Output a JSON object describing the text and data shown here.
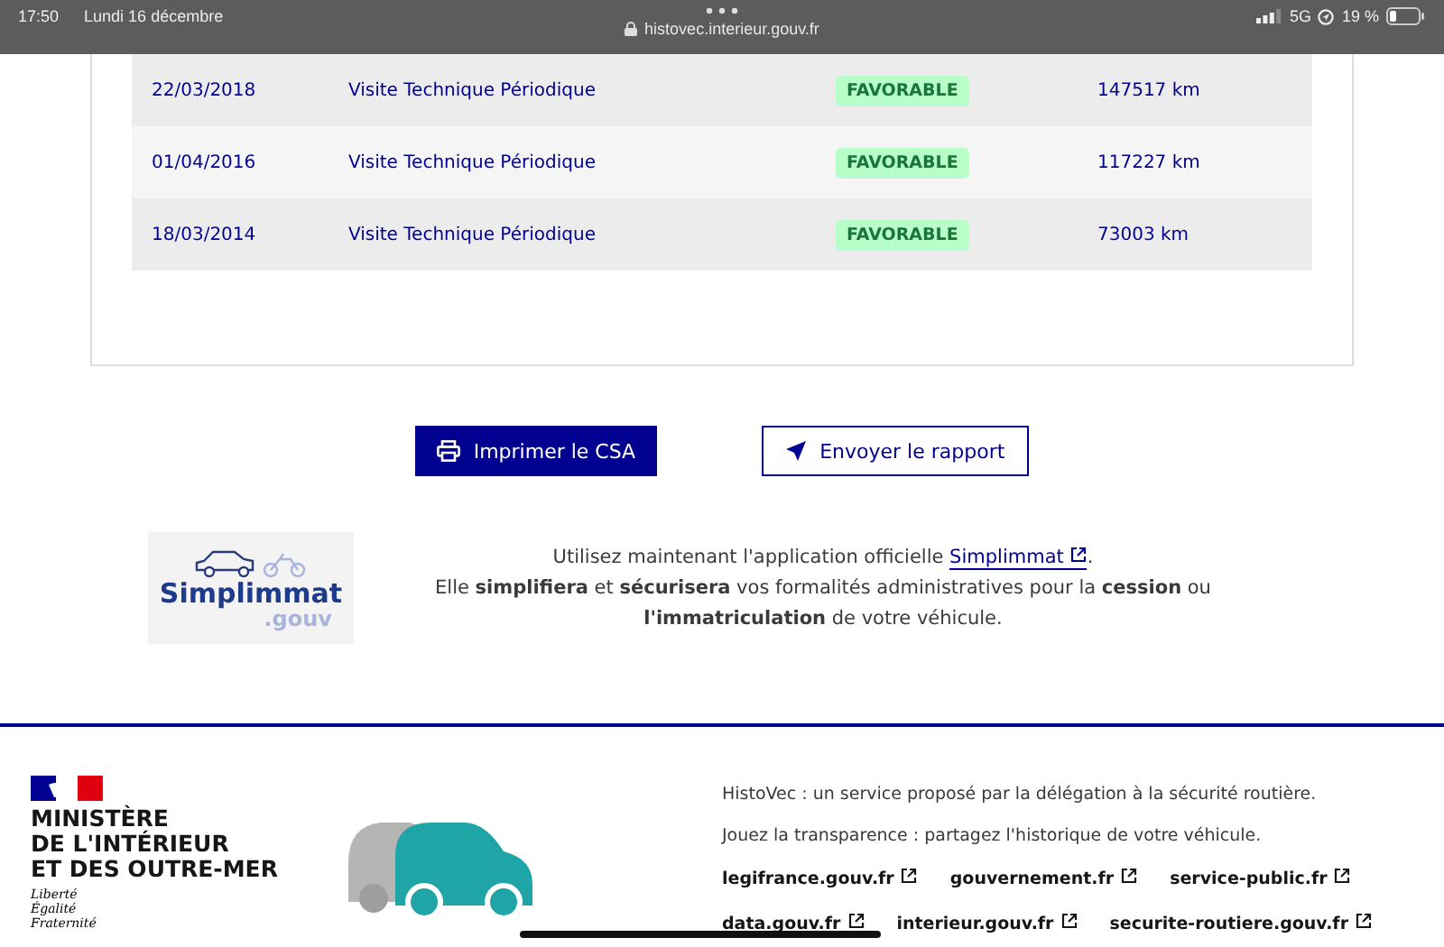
{
  "status_bar": {
    "time": "17:50",
    "date": "Lundi 16 décembre",
    "url": "histovec.interieur.gouv.fr",
    "network": "5G",
    "battery": "19 %"
  },
  "table": {
    "rows": [
      {
        "date": "22/03/2018",
        "type": "Visite Technique Périodique",
        "result": "FAVORABLE",
        "mileage": "147517 km"
      },
      {
        "date": "01/04/2016",
        "type": "Visite Technique Périodique",
        "result": "FAVORABLE",
        "mileage": "117227 km"
      },
      {
        "date": "18/03/2014",
        "type": "Visite Technique Périodique",
        "result": "FAVORABLE",
        "mileage": "73003 km"
      }
    ]
  },
  "buttons": [
    {
      "label": "Imprimer le CSA",
      "kind": "primary"
    },
    {
      "label": "Envoyer le rapport",
      "kind": "secondary"
    }
  ],
  "promo": {
    "logo_name": "Simplimmat",
    "logo_suffix": ".gouv",
    "line1": "Utilisez maintenant l'application officielle",
    "link": "Simplimmat",
    "line1_end": ".",
    "line2": "Elle **simplifiera** et **sécurisera** vos formalités administratives pour la **cession** ou **l'immatriculation** de votre véhicule."
  },
  "footer": {
    "ministry": [
      "MINISTÈRE",
      "DE L'INTÉRIEUR",
      "ET DES OUTRE-MER"
    ],
    "motto": [
      "Liberté",
      "Égalité",
      "Fraternité"
    ],
    "description": "HistoVec : un service proposé par la délégation à la sécurité routière.",
    "tagline": "Jouez la transparence : partagez l'historique de votre véhicule.",
    "links": [
      [
        "legifrance.gouv.fr",
        "gouvernement.fr",
        "service-public.fr"
      ],
      [
        "data.gouv.fr",
        "interieur.gouv.fr",
        "securite-routiere.gouv.fr"
      ]
    ]
  }
}
